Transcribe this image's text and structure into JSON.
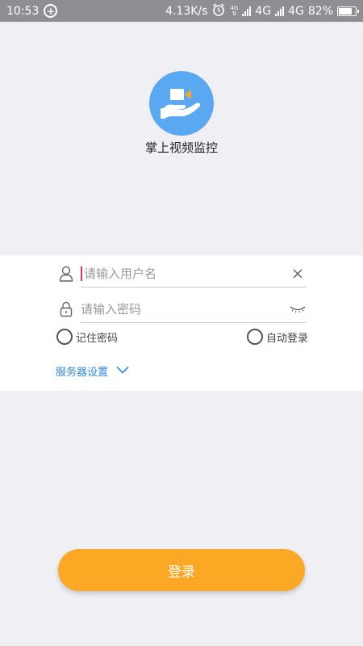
{
  "status_bar": {
    "time": "10:53",
    "network_speed": "4.13K/s",
    "sim1_label": "4G",
    "sim2_label": "4G",
    "battery_percent": "82%",
    "battery_level": 0.82,
    "small_net_label": "4G"
  },
  "app": {
    "name": "掌上视频监控",
    "logo_color": "#5ba8f2"
  },
  "form": {
    "username_placeholder": "请输入用户名",
    "username_value": "",
    "password_placeholder": "请输入密码",
    "password_value": "",
    "remember_label": "记住密码",
    "auto_login_label": "自动登录",
    "server_settings_label": "服务器设置"
  },
  "login_button": {
    "label": "登录",
    "color": "#fba825"
  },
  "colors": {
    "accent_blue": "#2f8ae0",
    "caret": "#e3306f"
  }
}
